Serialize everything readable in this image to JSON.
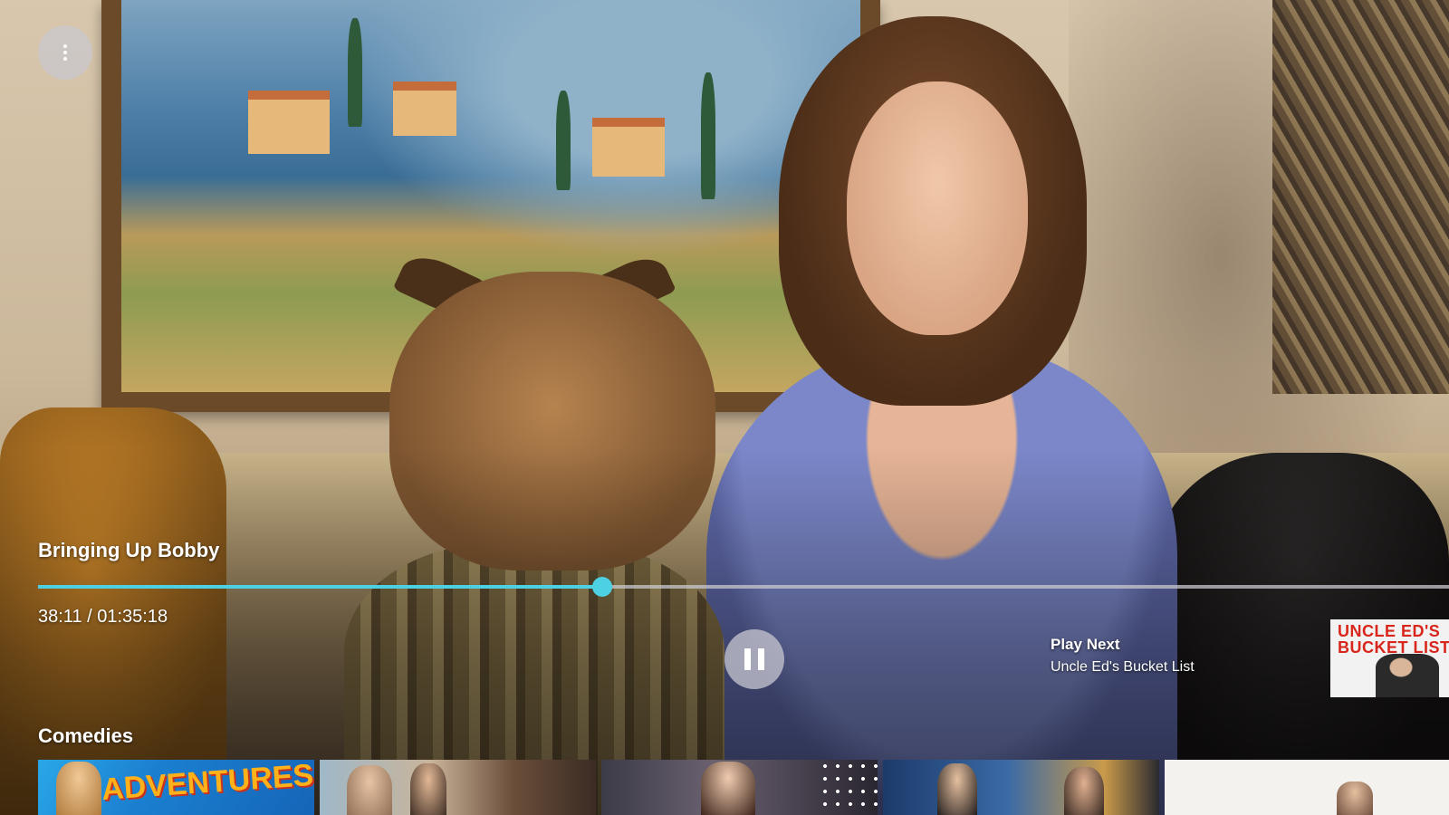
{
  "player": {
    "title": "Bringing Up Bobby",
    "time_display": "38:11 / 01:35:18",
    "progress": 0.4,
    "accent_color": "#4dd0e1",
    "menu_icon": "more-vertical-icon",
    "pause_icon": "pause-icon"
  },
  "play_next": {
    "label": "Play Next",
    "title": "Uncle Ed's Bucket List",
    "thumbnail_text": "UNCLE ED'S BUCKET LIST"
  },
  "row": {
    "title": "Comedies",
    "cards": [
      {
        "art_text": "ADVENTURES"
      },
      {
        "art_text": ""
      },
      {
        "art_text": ""
      },
      {
        "art_text": ""
      },
      {
        "art_text": ""
      }
    ]
  }
}
